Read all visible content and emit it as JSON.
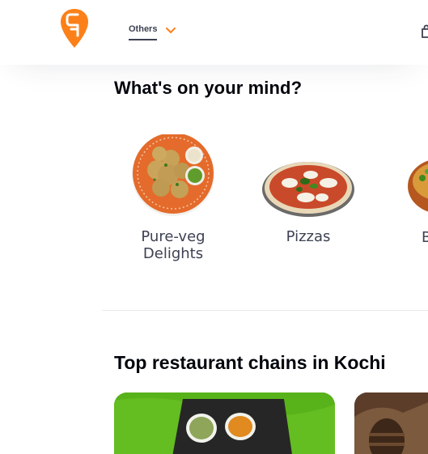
{
  "header": {
    "location_label": "Others",
    "icons": [
      "swiggy-logo-icon",
      "chevron-down-icon",
      "cart-icon"
    ],
    "brand_color": "#fc8019"
  },
  "mind": {
    "title": "What's on your mind?",
    "categories": [
      {
        "label_line1": "Pure-veg",
        "label_line2": "Delights"
      },
      {
        "label_line1": "Pizzas",
        "label_line2": ""
      },
      {
        "label_line1": "B",
        "label_line2": ""
      }
    ]
  },
  "chains": {
    "title": "Top restaurant chains in Kochi"
  }
}
